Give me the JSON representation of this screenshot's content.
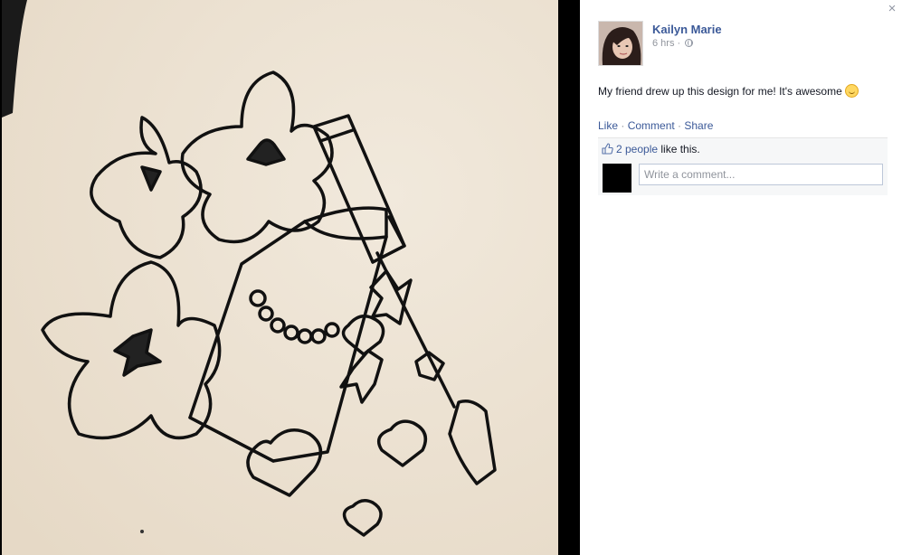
{
  "post": {
    "author": "Kailyn Marie",
    "time": "6 hrs",
    "separator": " · ",
    "text": "My friend drew up this design for me! It's awesome",
    "emoji": "smiling-face-emoji"
  },
  "actions": {
    "like": "Like",
    "comment": "Comment",
    "share": "Share",
    "separator": " · "
  },
  "likes": {
    "count_label": "2 people",
    "suffix": " like this."
  },
  "comment": {
    "placeholder": "Write a comment..."
  },
  "close_icon": "×",
  "colors": {
    "link": "#3b5998",
    "muted": "#90949c",
    "ufi_bg": "#f6f7f8",
    "photo_bg": "#000000",
    "paper": "#ede3d4"
  }
}
